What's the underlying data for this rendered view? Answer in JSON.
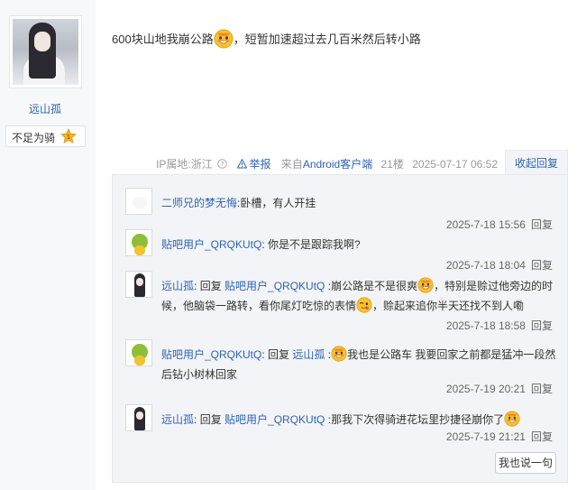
{
  "author": {
    "name": "远山孤",
    "badge_label": "不足为骑",
    "level": "1"
  },
  "post": {
    "text_before": "600块山地我崩公路",
    "text_after": "，短暂加速超过去几百米然后转小路",
    "meta": {
      "ip": "IP属地:浙江",
      "report": "举报",
      "client_prefix": "来自",
      "client": "Android客户端",
      "floor": "21楼",
      "time": "2025-07-17 06:52"
    },
    "collapse_label": "收起回复"
  },
  "replies": [
    {
      "user": "二师兄的梦无悔",
      "reply_word": "",
      "target": "",
      "text": ":卧槽，有人开挂",
      "time": "2025-7-18 15:56",
      "reply_btn": "回复"
    },
    {
      "user": "贴吧用户_QRQKUtQ",
      "reply_word": "",
      "target": "",
      "text": ": 你是不是跟踪我啊?",
      "time": "2025-7-18 18:04",
      "reply_btn": "回复"
    },
    {
      "user": "远山孤",
      "reply_word": "回复",
      "target": "贴吧用户_QRQKUtQ",
      "text_1": ":崩公路是不是很爽",
      "text_2": "，特别是赊过他旁边的时候，他脑袋一路转，看你尾灯吃惊的表情",
      "text_3": "，赊起来追你半天还找不到人嘞",
      "time": "2025-7-18 18:58",
      "reply_btn": "回复"
    },
    {
      "user": "贴吧用户_QRQKUtQ",
      "reply_word": "回复",
      "target": "远山孤",
      "text": "我也是公路车 我要回家之前都是猛冲一段然后钻小树林回家",
      "time": "2025-7-19 20:21",
      "reply_btn": "回复"
    },
    {
      "user": "远山孤",
      "reply_word": "回复",
      "target": "贴吧用户_QRQKUtQ",
      "text": ":那我下次得骑进花坛里抄捷径崩你了",
      "time": "2025-7-19 21:21",
      "reply_btn": "回复"
    }
  ],
  "say_button": "我也说一句",
  "colors": {
    "link": "#2d64b3",
    "panel_bg": "#f3f4f7",
    "level_badge": "#f5b51b"
  }
}
